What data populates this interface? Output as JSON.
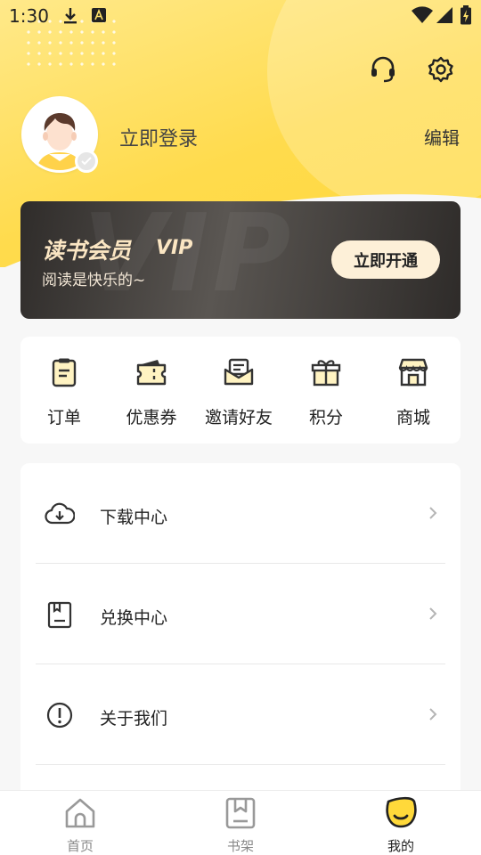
{
  "status_bar": {
    "time": "1:30"
  },
  "profile": {
    "login_label": "立即登录",
    "edit_label": "编辑"
  },
  "vip": {
    "title": "读书会员",
    "tag": "VIP",
    "subtitle": "阅读是快乐的~",
    "button": "立即开通",
    "accent": "#fbe6c3"
  },
  "quick_actions": [
    {
      "label": "订单",
      "icon": "clipboard-icon"
    },
    {
      "label": "优惠券",
      "icon": "ticket-icon"
    },
    {
      "label": "邀请好友",
      "icon": "mail-icon"
    },
    {
      "label": "积分",
      "icon": "gift-icon"
    },
    {
      "label": "商城",
      "icon": "store-icon"
    }
  ],
  "menu": [
    {
      "label": "下载中心",
      "icon": "cloud-download-icon"
    },
    {
      "label": "兑换中心",
      "icon": "redeem-icon"
    },
    {
      "label": "关于我们",
      "icon": "info-icon"
    }
  ],
  "nav": [
    {
      "label": "首页",
      "icon": "home-icon"
    },
    {
      "label": "书架",
      "icon": "bookshelf-icon"
    },
    {
      "label": "我的",
      "icon": "smile-icon",
      "active": true
    }
  ],
  "colors": {
    "brand_yellow": "#ffd93a",
    "text": "#222222"
  }
}
